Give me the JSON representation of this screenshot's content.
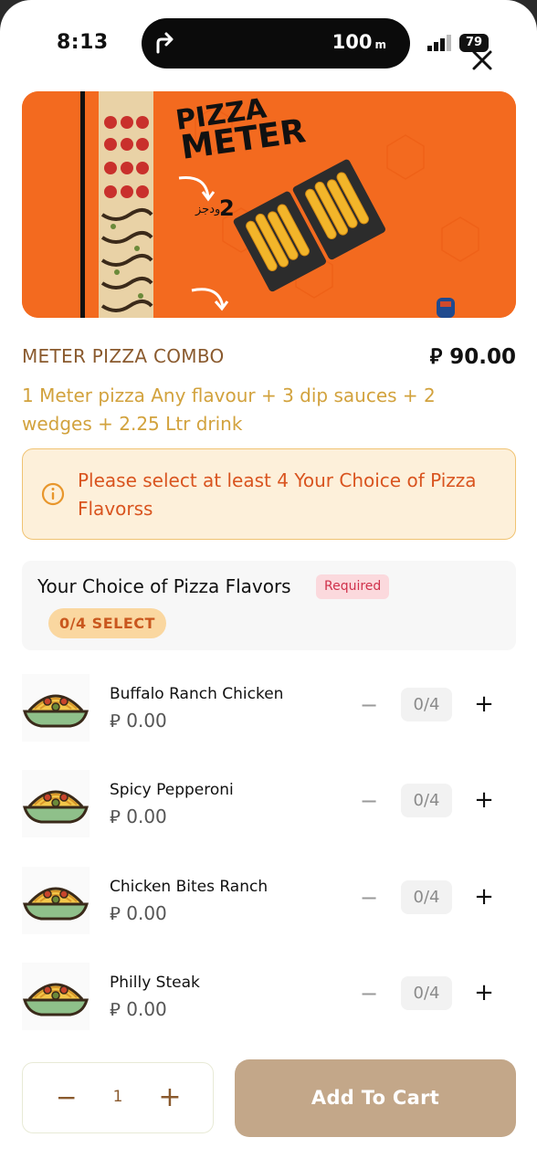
{
  "status_bar": {
    "time": "8:13",
    "distance": "100",
    "distance_unit": "m",
    "battery": "79"
  },
  "banner": {
    "headline_line1": "PIZZA",
    "headline_line2": "METER",
    "wedges_count": "2",
    "wedges_label": "ودجز"
  },
  "product": {
    "title": "METER PIZZA COMBO",
    "price": "⃁ 90.00",
    "description": "1 Meter pizza Any flavour + 3 dip sauces +  2 wedges + 2.25 Ltr drink"
  },
  "alert": {
    "message": "Please select at least 4 Your Choice of Pizza Flavorss"
  },
  "group": {
    "title": "Your Choice of Pizza Flavors",
    "required_label": "Required",
    "select_label": "0/4 SELECT"
  },
  "items": [
    {
      "name": "Buffalo Ranch Chicken",
      "price": "⃁ 0.00",
      "count": "0/4",
      "minus": "−",
      "plus": "+"
    },
    {
      "name": "Spicy Pepperoni",
      "price": "⃁ 0.00",
      "count": "0/4",
      "minus": "−",
      "plus": "+"
    },
    {
      "name": "Chicken Bites Ranch",
      "price": "⃁ 0.00",
      "count": "0/4",
      "minus": "−",
      "plus": "+"
    },
    {
      "name": "Philly Steak",
      "price": "⃁ 0.00",
      "count": "0/4",
      "minus": "−",
      "plus": "+"
    }
  ],
  "footer": {
    "qty_minus": "−",
    "quantity": "1",
    "qty_plus": "+",
    "add_to_cart": "Add To Cart"
  },
  "colors": {
    "accent": "#c3a789",
    "banner": "#f36a1f",
    "alert_bg": "#fdf0da",
    "alert_text": "#d9541f",
    "title": "#8a5a2e",
    "desc": "#d2a23d"
  },
  "icons": {
    "close": "close-icon",
    "info": "info-icon",
    "navigation": "turn-right-arrow-icon",
    "item_thumb": "pasta-bowl-icon"
  }
}
